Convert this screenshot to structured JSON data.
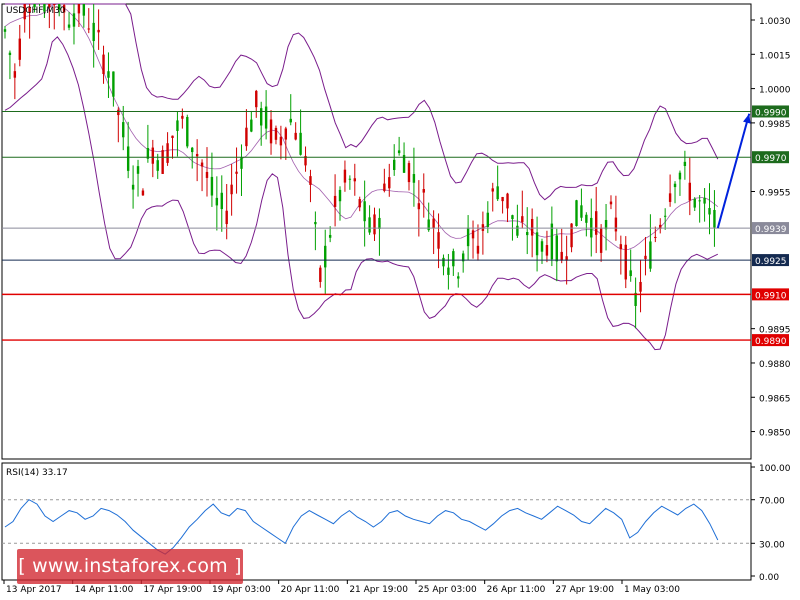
{
  "chart_data": {
    "type": "line",
    "symbol": "USDCHF,M30",
    "colors": {
      "bull": "#00a000",
      "bear": "#d00000",
      "bands": "#7a1d8c",
      "rsi": "#1f6fd6",
      "arrow": "#0022dd",
      "green_level": "#1d6b1d",
      "red_level": "#e00000",
      "gray_level": "#8a8a9a",
      "navy_level": "#142a50"
    },
    "price_axis": {
      "ylim": [
        0.9838,
        1.0037
      ],
      "tick_labels": [
        "1.0030",
        "1.0015",
        "1.0000",
        "0.9985",
        "0.9955",
        "0.9895",
        "0.9880",
        "0.9865",
        "0.9850"
      ],
      "tick_values": [
        1.003,
        1.0015,
        1.0,
        0.9985,
        0.9955,
        0.9895,
        0.988,
        0.9865,
        0.985
      ]
    },
    "levels": [
      {
        "label": "0.9990",
        "value": 0.999,
        "color_key": "green_level"
      },
      {
        "label": "0.9970",
        "value": 0.997,
        "color_key": "green_level"
      },
      {
        "label": "0.9939",
        "value": 0.9939,
        "color_key": "gray_level"
      },
      {
        "label": "0.9925",
        "value": 0.9925,
        "color_key": "navy_level"
      },
      {
        "label": "0.9910",
        "value": 0.991,
        "color_key": "red_level"
      },
      {
        "label": "0.9890",
        "value": 0.989,
        "color_key": "red_level"
      }
    ],
    "x_labels": [
      "13 Apr 2017",
      "14 Apr 11:00",
      "17 Apr 19:00",
      "19 Apr 03:00",
      "20 Apr 11:00",
      "21 Apr 19:00",
      "25 Apr 03:00",
      "26 Apr 11:00",
      "27 Apr 19:00",
      "1 May 03:00"
    ],
    "price_path": [
      [
        0,
        1.0025
      ],
      [
        2,
        1.0005
      ],
      [
        4,
        1.004
      ],
      [
        6,
        1.0042
      ],
      [
        8,
        1.0038
      ],
      [
        10,
        1.004
      ],
      [
        12,
        1.0032
      ],
      [
        14,
        1.0036
      ],
      [
        16,
        1.003
      ],
      [
        18,
        1.0018
      ],
      [
        20,
        1.0008
      ],
      [
        22,
        0.9985
      ],
      [
        24,
        0.9965
      ],
      [
        26,
        0.9958
      ],
      [
        28,
        0.9975
      ],
      [
        30,
        0.9968
      ],
      [
        32,
        0.998
      ],
      [
        34,
        0.9985
      ],
      [
        36,
        0.9976
      ],
      [
        38,
        0.9965
      ],
      [
        40,
        0.995
      ],
      [
        42,
        0.9945
      ],
      [
        44,
        0.9962
      ],
      [
        46,
        0.998
      ],
      [
        48,
        0.9992
      ],
      [
        50,
        0.9985
      ],
      [
        52,
        0.9975
      ],
      [
        54,
        0.9988
      ],
      [
        56,
        0.998
      ],
      [
        58,
        0.9965
      ],
      [
        60,
        0.9915
      ],
      [
        62,
        0.9938
      ],
      [
        64,
        0.9955
      ],
      [
        66,
        0.996
      ],
      [
        68,
        0.9948
      ],
      [
        70,
        0.9935
      ],
      [
        72,
        0.995
      ],
      [
        74,
        0.9968
      ],
      [
        76,
        0.9972
      ],
      [
        78,
        0.996
      ],
      [
        80,
        0.995
      ],
      [
        82,
        0.994
      ],
      [
        84,
        0.9928
      ],
      [
        86,
        0.992
      ],
      [
        88,
        0.9935
      ],
      [
        90,
        0.993
      ],
      [
        92,
        0.9945
      ],
      [
        94,
        0.9958
      ],
      [
        96,
        0.995
      ],
      [
        98,
        0.9935
      ],
      [
        100,
        0.994
      ],
      [
        102,
        0.993
      ],
      [
        104,
        0.9935
      ],
      [
        106,
        0.9925
      ],
      [
        108,
        0.9938
      ],
      [
        110,
        0.9948
      ],
      [
        112,
        0.9942
      ],
      [
        114,
        0.9935
      ],
      [
        116,
        0.9945
      ],
      [
        118,
        0.993
      ],
      [
        120,
        0.9905
      ],
      [
        122,
        0.992
      ],
      [
        124,
        0.9935
      ],
      [
        126,
        0.995
      ],
      [
        128,
        0.9965
      ],
      [
        130,
        0.996
      ],
      [
        132,
        0.995
      ],
      [
        134,
        0.9945
      ],
      [
        136,
        0.9939
      ]
    ],
    "forecast_arrow": {
      "from": [
        136,
        0.9939
      ],
      "to": [
        142,
        0.9989
      ]
    },
    "rsi": {
      "title": "RSI(14) 33.17",
      "ylim": [
        0,
        100
      ],
      "tick_labels": [
        "100.00",
        "70.00",
        "30.00",
        "0.00"
      ],
      "tick_values": [
        100,
        70,
        30,
        0
      ],
      "dashed_levels": [
        70,
        30
      ],
      "values": [
        45,
        50,
        62,
        70,
        66,
        55,
        50,
        55,
        60,
        58,
        52,
        55,
        62,
        60,
        56,
        50,
        42,
        36,
        30,
        24,
        20,
        26,
        35,
        45,
        52,
        60,
        66,
        58,
        55,
        62,
        60,
        50,
        45,
        40,
        35,
        30,
        45,
        55,
        60,
        56,
        52,
        48,
        55,
        60,
        54,
        50,
        45,
        50,
        58,
        60,
        55,
        52,
        50,
        48,
        55,
        60,
        58,
        52,
        50,
        46,
        42,
        48,
        55,
        60,
        62,
        58,
        55,
        52,
        58,
        64,
        60,
        56,
        50,
        48,
        55,
        62,
        58,
        52,
        35,
        40,
        50,
        58,
        64,
        60,
        56,
        62,
        66,
        60,
        48,
        33
      ]
    }
  },
  "watermark": "[ www.instaforex.com ]"
}
